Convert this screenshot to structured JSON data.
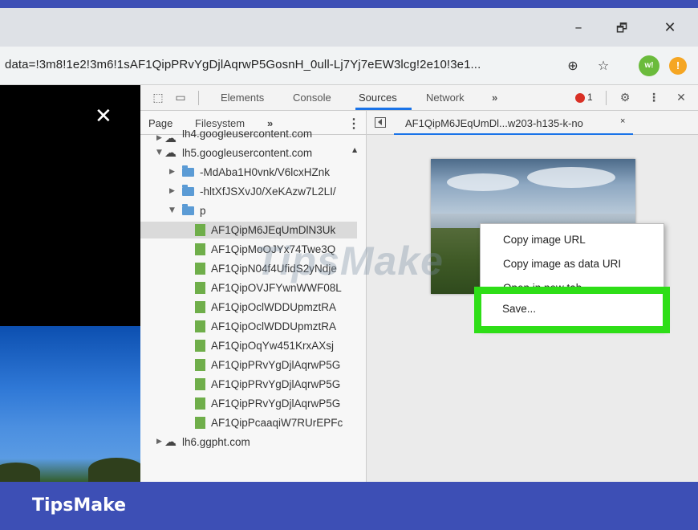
{
  "window": {
    "minimize_glyph": "–",
    "restore_glyph": "🗗",
    "close_glyph": "✕"
  },
  "address_bar": {
    "url": "data=!3m8!1e2!3m6!1sAF1QipPRvYgDjlAqrwP5GosnH_0ull-Lj7Yj7eEW3lcg!2e10!3e1...",
    "extension_label": "w!"
  },
  "page": {
    "close_glyph": "✕"
  },
  "devtools": {
    "tabs": [
      "Elements",
      "Console",
      "Sources",
      "Network"
    ],
    "active_tab": "Sources",
    "more_tabs": "»",
    "error_count": "1",
    "navigator": {
      "tabs": [
        "Page",
        "Filesystem"
      ],
      "more": "»",
      "tree": [
        {
          "label": "lh4.googleusercontent.com",
          "type": "domain"
        },
        {
          "label": "lh5.googleusercontent.com",
          "type": "domain"
        },
        {
          "label": "-MdAba1H0vnk/V6lcxHZnk",
          "type": "folder"
        },
        {
          "label": "-hltXfJSXvJ0/XeKAzw7L2LI/",
          "type": "folder"
        },
        {
          "label": "p",
          "type": "folder"
        },
        {
          "label": "AF1QipM6JEqUmDlN3Uk",
          "type": "file",
          "selected": true
        },
        {
          "label": "AF1QipMoOJYx74Twe3Q",
          "type": "file"
        },
        {
          "label": "AF1QipN04f4UfidS2yNdje",
          "type": "file"
        },
        {
          "label": "AF1QipOVJFYwnWWF08L",
          "type": "file"
        },
        {
          "label": "AF1QipOclWDDUpmztRA",
          "type": "file"
        },
        {
          "label": "AF1QipOclWDDUpmztRA",
          "type": "file"
        },
        {
          "label": "AF1QipOqYw451KrxAXsj",
          "type": "file"
        },
        {
          "label": "AF1QipPRvYgDjlAqrwP5G",
          "type": "file"
        },
        {
          "label": "AF1QipPRvYgDjlAqrwP5G",
          "type": "file"
        },
        {
          "label": "AF1QipPRvYgDjlAqrwP5G",
          "type": "file"
        },
        {
          "label": "AF1QipPcaaqiW7RUrEPFc",
          "type": "file"
        },
        {
          "label": "lh6.ggpht.com",
          "type": "domain"
        }
      ]
    },
    "editor": {
      "open_file": "AF1QipM6JEqUmDl...w203-h135-k-no",
      "close_glyph": "×"
    }
  },
  "context_menu": {
    "items": [
      "Copy image URL",
      "Copy image as data URI",
      "Open in new tab"
    ],
    "save": "Save..."
  },
  "watermark": "TipsMake",
  "brand": "TipsMake",
  "colors": {
    "highlight": "#2ede17",
    "brand_bar": "#3d4fb5",
    "accent": "#1a73e8"
  }
}
